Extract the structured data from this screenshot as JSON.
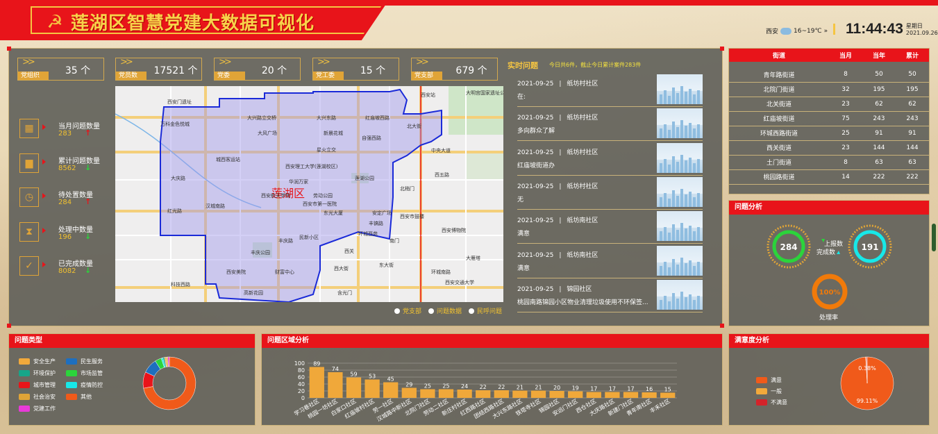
{
  "header": {
    "title": "莲湖区智慧党建大数据可视化",
    "city": "西安",
    "temp": "16~19℃",
    "more": "»",
    "time": "11:44:43",
    "weekday": "星期日",
    "date": "2021.09.26"
  },
  "stats": [
    {
      "label": "党组织",
      "value": "35 个"
    },
    {
      "label": "党员数",
      "value": "17521 个"
    },
    {
      "label": "党委",
      "value": "20 个"
    },
    {
      "label": "党工委",
      "value": "15 个"
    },
    {
      "label": "党支部",
      "value": "679 个"
    }
  ],
  "side_stats": [
    {
      "label": "当月问题数量",
      "value": "283",
      "icon": "calendar-icon",
      "arrow": "up",
      "arrow_char": "↑",
      "arrow_color": "#e8141a"
    },
    {
      "label": "累计问题数量",
      "value": "8562",
      "icon": "bar-chart-icon",
      "arrow": "down",
      "arrow_char": "↓",
      "arrow_color": "#2bd43b"
    },
    {
      "label": "待处置数量",
      "value": "284",
      "icon": "clock-icon",
      "arrow": "up",
      "arrow_char": "↑",
      "arrow_color": "#e8141a"
    },
    {
      "label": "处理中数量",
      "value": "196",
      "icon": "hourglass-icon",
      "arrow": "down",
      "arrow_char": "↓",
      "arrow_color": "#2bd43b"
    },
    {
      "label": "已完成数量",
      "value": "8082",
      "icon": "check-circle-icon",
      "arrow": "down",
      "arrow_char": "↓",
      "arrow_color": "#2bd43b"
    }
  ],
  "map": {
    "district_label": "莲湖区",
    "places": [
      "西安门遗址",
      "大兴路立交桥",
      "大兴东路",
      "红庙坡西路",
      "大风广场",
      "新晨花城",
      "自强西路",
      "万科金色悦城",
      "城西客运站",
      "星火立交",
      "西安理工大学(莲湖校区)",
      "华润万家",
      "莲湖公园",
      "大庆路",
      "西五路",
      "汉城南路",
      "丰镐路",
      "西安航天学院",
      "西安市第一医院",
      "东光大厦",
      "环城西苑",
      "丰庆路",
      "民新小区",
      "西安市鼓楼",
      "西安博物院",
      "高新花园",
      "财富中心",
      "东大街",
      "科技西路",
      "北大街",
      "大雁塔",
      "西关",
      "西安站",
      "大明宫国家遗址公园",
      "中央大道",
      "红光路",
      "劳动公园",
      "环城南路",
      "西安交通大学",
      "西大街",
      "南门",
      "安定广场",
      "丰庆公园",
      "西安美院",
      "北稍门",
      "含光门"
    ],
    "legend": [
      "党支部",
      "问题数据",
      "民呼问题"
    ]
  },
  "realtime": {
    "title": "实时问题",
    "summary": "今日共6件，截止今日累计案件283件",
    "items": [
      {
        "date": "2021-09-25",
        "sep": "|",
        "community": "纸坊村社区",
        "content": "在:"
      },
      {
        "date": "2021-09-25",
        "sep": "|",
        "community": "纸坊村社区",
        "content": "多向群众了解"
      },
      {
        "date": "2021-09-25",
        "sep": "|",
        "community": "纸坊村社区",
        "content": "红庙坡街道办"
      },
      {
        "date": "2021-09-25",
        "sep": "|",
        "community": "纸坊村社区",
        "content": "无"
      },
      {
        "date": "2021-09-25",
        "sep": "|",
        "community": "纸坊南社区",
        "content": "满意"
      },
      {
        "date": "2021-09-25",
        "sep": "|",
        "community": "纸坊南社区",
        "content": "满意"
      },
      {
        "date": "2021-09-25",
        "sep": "|",
        "community": "锦园社区",
        "content": "桃园南路锦园小区物业清理垃圾使用不环保签..."
      }
    ]
  },
  "street_table": {
    "headers": [
      "街道",
      "当月",
      "当年",
      "累计"
    ],
    "rows": [
      [
        "青年路街道",
        "8",
        "50",
        "50"
      ],
      [
        "北院门街道",
        "32",
        "195",
        "195"
      ],
      [
        "北关街道",
        "23",
        "62",
        "62"
      ],
      [
        "红庙坡街道",
        "75",
        "243",
        "243"
      ],
      [
        "环城西路街道",
        "25",
        "91",
        "91"
      ],
      [
        "西关街道",
        "23",
        "144",
        "144"
      ],
      [
        "土门街道",
        "8",
        "63",
        "63"
      ],
      [
        "桃园路街道",
        "14",
        "222",
        "222"
      ]
    ]
  },
  "problem_analysis": {
    "title": "问题分析",
    "reported": "284",
    "reported_label": "上报数",
    "completed": "191",
    "completed_label": "完成数",
    "rate": "100%",
    "rate_label": "处理率"
  },
  "problem_types": {
    "title": "问题类型",
    "items": [
      {
        "name": "安全生产",
        "color": "#f2a93b"
      },
      {
        "name": "民生服务",
        "color": "#1e6fbf"
      },
      {
        "name": "环境保护",
        "color": "#17a589"
      },
      {
        "name": "市场监管",
        "color": "#2bd43b"
      },
      {
        "name": "城市管理",
        "color": "#e8141a"
      },
      {
        "name": "疫情防控",
        "color": "#17e8e8"
      },
      {
        "name": "社会治安",
        "color": "#e0a437"
      },
      {
        "name": "其他",
        "color": "#f05a1a"
      },
      {
        "name": "党建工作",
        "color": "#e83ad8"
      }
    ]
  },
  "region_analysis": {
    "title": "问题区域分析"
  },
  "satisfaction": {
    "title": "满意度分析"
  },
  "chart_data": [
    {
      "type": "bar",
      "categories": [
        "学习巷社区",
        "桃园一坊社区",
        "白家口社区",
        "红庙坡村社区",
        "劳一社区",
        "汉城路中新社区",
        "北院门社区",
        "劳动二社区",
        "新庄村社区",
        "红西路社区",
        "团结西路社区",
        "大兴东路社区",
        "铁塔寺社区",
        "锦园社区",
        "安远门社区",
        "西仓社区",
        "大庆路社区",
        "新建门社区",
        "青年南社区",
        "丰禾社区"
      ],
      "values": [
        89,
        74,
        59,
        53,
        45,
        29,
        25,
        25,
        24,
        22,
        22,
        21,
        21,
        20,
        19,
        17,
        17,
        17,
        16,
        15
      ],
      "title": "",
      "xlabel": "",
      "ylabel": "",
      "yticks": [
        0,
        20,
        40,
        60,
        80,
        100
      ],
      "ylim": [
        0,
        100
      ],
      "grid": true,
      "color": "#f0a83a"
    },
    {
      "type": "pie",
      "labels": [
        "满意",
        "一般",
        "不满意"
      ],
      "values": [
        99.11,
        0.38,
        0.51
      ],
      "value_labels": [
        "99.11%",
        "0.38%",
        ""
      ],
      "colors": [
        "#f05a1a",
        "#f2a93b",
        "#d4232a"
      ]
    },
    {
      "type": "pie",
      "labels": [
        "其他",
        "城市管理",
        "民生服务",
        "市场监管",
        "疫情防控",
        "环境保护",
        "安全生产",
        "社会治安",
        "党建工作"
      ],
      "values": [
        72,
        10,
        9,
        4,
        1,
        1,
        1,
        1,
        1
      ],
      "colors": [
        "#f05a1a",
        "#e8141a",
        "#1e6fbf",
        "#2bd43b",
        "#17e8e8",
        "#17a589",
        "#f2a93b",
        "#e0a437",
        "#e83ad8"
      ],
      "donut": true
    }
  ]
}
